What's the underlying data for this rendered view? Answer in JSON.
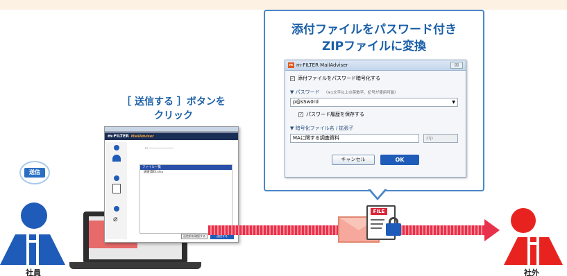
{
  "callout": {
    "title_line1": "添付ファイルをパスワード付き",
    "title_line2": "ZIPファイルに変換"
  },
  "dialog": {
    "title": "m-FILTER MailAdviser",
    "close_label": "☒",
    "encrypt_checkbox_label": "添付ファイルをパスワード暗号化する",
    "password_section_label": "▼ パスワード",
    "password_hint": "（※1文字以上の英数字、記号が使用可能）",
    "password_value": "p@sSw0rd",
    "save_history_label": "パスワード履歴を保存する",
    "filename_section_label": "▼ 暗号化ファイル名 / 拡張子",
    "filename_value": "MAに関する調査資料",
    "extension_value": "zip",
    "cancel_label": "キャンセル",
    "ok_label": "OK"
  },
  "caption": {
    "line1": "［ 送信する ］ボタンを",
    "line2": "クリック"
  },
  "bubble": {
    "label": "送信"
  },
  "sender": {
    "label": "社員"
  },
  "receiver": {
    "label": "社外"
  },
  "file_badge": {
    "label": "FILE"
  },
  "app_window": {
    "brand": "m-FILTER",
    "brand_sub": "MailAdviser",
    "list_header": "ファイル一覧",
    "list_item": "調査資料.xlsx",
    "save_button": "送信前を確認する",
    "send_button": "送信する"
  },
  "colors": {
    "accent_blue": "#1f5bb8",
    "title_blue": "#1a5fa8",
    "receiver_red": "#e8231f",
    "arrow_red": "#e8314a"
  },
  "icons": [
    "person-icon",
    "laptop-icon",
    "envelope-icon",
    "file-icon",
    "lock-icon",
    "checkbox-icon",
    "chevron-down-icon",
    "close-icon"
  ]
}
